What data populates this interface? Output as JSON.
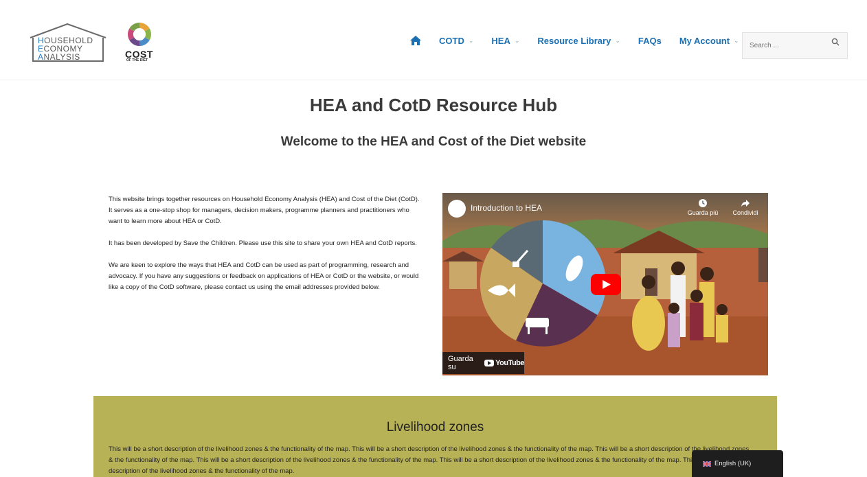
{
  "header": {
    "hea_logo": {
      "line1": "OUSEHOLD",
      "line1_initial": "H",
      "line2": "CONOMY",
      "line2_initial": "E",
      "line3": "NALYSIS",
      "line3_initial": "A"
    },
    "cotd_logo": {
      "word": "COST",
      "sub": "OF THE DIET"
    },
    "nav": [
      {
        "label": "COTD",
        "dropdown": true
      },
      {
        "label": "HEA",
        "dropdown": true
      },
      {
        "label": "Resource Library",
        "dropdown": true
      },
      {
        "label": "FAQs",
        "dropdown": false
      },
      {
        "label": "My Account",
        "dropdown": true
      }
    ],
    "search": {
      "placeholder": "Search ..."
    }
  },
  "main": {
    "title": "HEA and CotD Resource Hub",
    "subtitle": "Welcome to the HEA and Cost of the Diet website",
    "intro": [
      "This website brings together resources on Household Economy Analysis (HEA) and Cost of the Diet (CotD). It serves as a one-stop shop for managers, decision makers, programme planners and practitioners who want to learn more about HEA or CotD.",
      "It has been developed by Save the Children. Please use this site to share your own HEA and CotD reports.",
      "We are keen to explore the ways that HEA and CotD can be used as part of programming, research and advocacy. If you have any suggestions or feedback on applications of HEA or CotD or the website, or would like a copy of the CotD software, please contact us using the email addresses provided below."
    ],
    "video": {
      "title": "Introduction to HEA",
      "watch_later": "Guarda più",
      "share": "Condividi",
      "watch_on": "Guarda su",
      "youtube": "YouTube"
    }
  },
  "livelihood": {
    "title": "Livelihood zones",
    "description": "This will be a short description of the livelihood zones & the functionality of the map. This will be a short description of the livelihood zones & the functionality of the map. This will be a short description of the livelihood zones & the functionality of the map. This will be a short description of the livelihood zones & the functionality of the map. This will be a short description of the livelihood zones & the functionality of the map. This will be a short description of the livelihood zones & the functionality of the map."
  },
  "language": {
    "label": "English (UK)"
  },
  "colors": {
    "nav": "#1b6fb3",
    "band": "#b8b257",
    "accent_blue": "#2a7ac0"
  }
}
